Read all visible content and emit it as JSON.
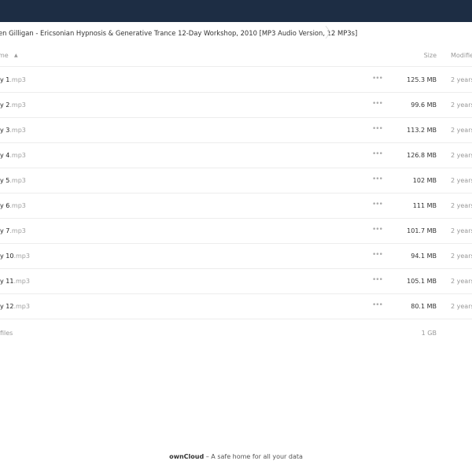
{
  "breadcrumb": {
    "path": "en Gilligan - Ericsonian Hypnosis & Generative Trance 12-Day Workshop, 2010 [MP3 Audio Version, 12 MP3s]"
  },
  "table": {
    "headers": {
      "name": "me",
      "size": "Size",
      "modified": "Modifie"
    },
    "sort_indicator": "▲",
    "rows": [
      {
        "base": "y 1",
        "ext": ".mp3",
        "size": "125.3 MB",
        "modified": "2 years"
      },
      {
        "base": "y 2",
        "ext": ".mp3",
        "size": "99.6 MB",
        "modified": "2 years"
      },
      {
        "base": "y 3",
        "ext": ".mp3",
        "size": "113.2 MB",
        "modified": "2 years"
      },
      {
        "base": "y 4",
        "ext": ".mp3",
        "size": "126.8 MB",
        "modified": "2 years"
      },
      {
        "base": "y 5",
        "ext": ".mp3",
        "size": "102 MB",
        "modified": "2 years"
      },
      {
        "base": "y 6",
        "ext": ".mp3",
        "size": "111 MB",
        "modified": "2 years"
      },
      {
        "base": "y 7",
        "ext": ".mp3",
        "size": "101.7 MB",
        "modified": "2 years"
      },
      {
        "base": "y 10",
        "ext": ".mp3",
        "size": "94.1 MB",
        "modified": "2 years"
      },
      {
        "base": "y 11",
        "ext": ".mp3",
        "size": "105.1 MB",
        "modified": "2 years"
      },
      {
        "base": "y 12",
        "ext": ".mp3",
        "size": "80.1 MB",
        "modified": "2 years"
      }
    ],
    "row_action": "•••"
  },
  "summary": {
    "files": "files",
    "size": "1 GB"
  },
  "footer": {
    "brand": "ownCloud",
    "tagline": " – A safe home for all your data"
  },
  "colors": {
    "topbar": "#1d2d44"
  }
}
